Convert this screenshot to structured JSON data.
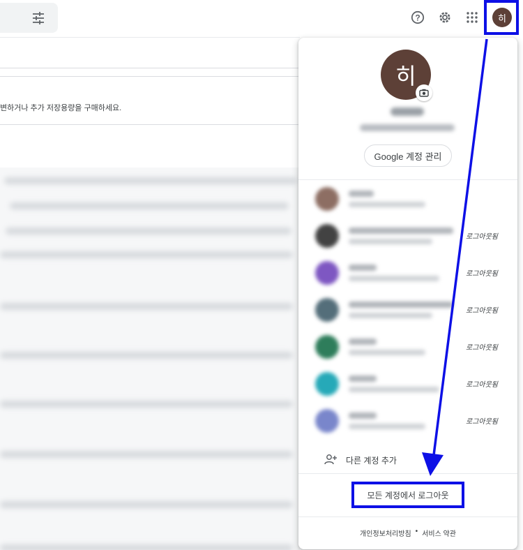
{
  "storage_message": "변하거나 추가 저장용량을 구매하세요.",
  "header": {
    "help_icon": "help-circle-icon",
    "settings_icon": "gear-icon",
    "apps_icon": "apps-grid-icon",
    "avatar_letter": "히"
  },
  "account_panel": {
    "avatar_letter": "히",
    "manage_button": "Google 계정 관리",
    "accounts": [
      {
        "status": "",
        "avatar_color": "#8d6e63"
      },
      {
        "status": "로그아웃됨",
        "avatar_color": "#424242"
      },
      {
        "status": "로그아웃됨",
        "avatar_color": "#7e57c2"
      },
      {
        "status": "로그아웃됨",
        "avatar_color": "#546e7a"
      },
      {
        "status": "로그아웃됨",
        "avatar_color": "#2e7d5b"
      },
      {
        "status": "로그아웃됨",
        "avatar_color": "#26a9b8"
      },
      {
        "status": "로그아웃됨",
        "avatar_color": "#7986cb"
      }
    ],
    "add_account": "다른 계정 추가",
    "sign_out_all": "모든 계정에서 로그아웃",
    "footer": {
      "privacy": "개인정보처리방침",
      "separator": "•",
      "terms": "서비스 약관"
    }
  },
  "colors": {
    "annotation": "#0d10e6",
    "avatar": "#5d4037"
  }
}
